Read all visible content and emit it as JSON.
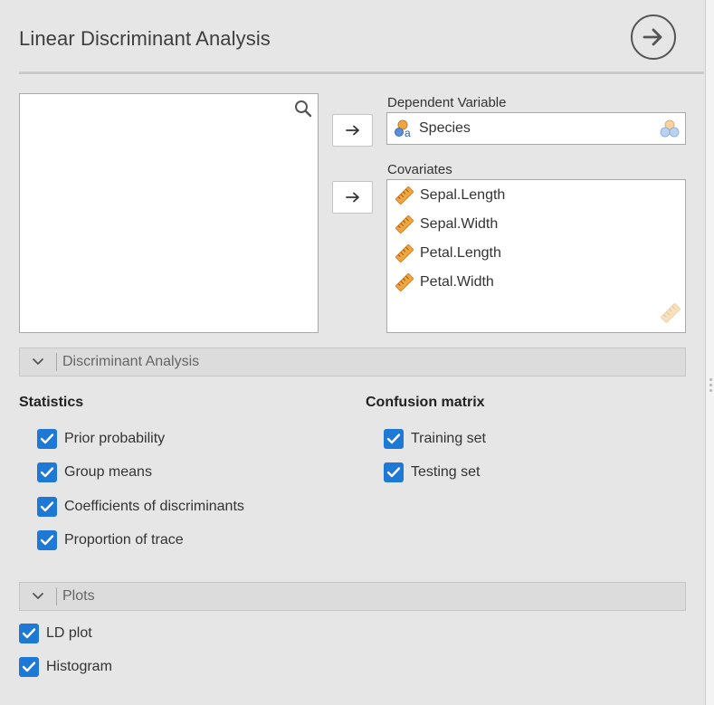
{
  "header": {
    "title": "Linear Discriminant Analysis"
  },
  "variables": {
    "dependent_label": "Dependent Variable",
    "dependent": [
      {
        "label": "Species",
        "icon": "nominal-variable-icon"
      }
    ],
    "covariates_label": "Covariates",
    "covariates": [
      {
        "label": "Sepal.Length",
        "icon": "continuous-variable-icon"
      },
      {
        "label": "Sepal.Width",
        "icon": "continuous-variable-icon"
      },
      {
        "label": "Petal.Length",
        "icon": "continuous-variable-icon"
      },
      {
        "label": "Petal.Width",
        "icon": "continuous-variable-icon"
      }
    ]
  },
  "sections": {
    "discriminant": {
      "header": "Discriminant Analysis",
      "statistics": {
        "title": "Statistics",
        "items": [
          {
            "label": "Prior probability",
            "checked": true
          },
          {
            "label": "Group means",
            "checked": true
          },
          {
            "label": "Coefficients of discriminants",
            "checked": true
          },
          {
            "label": "Proportion of trace",
            "checked": true
          }
        ]
      },
      "confusion": {
        "title": "Confusion matrix",
        "items": [
          {
            "label": "Training set",
            "checked": true
          },
          {
            "label": "Testing set",
            "checked": true
          }
        ]
      }
    },
    "plots": {
      "header": "Plots",
      "items": [
        {
          "label": "LD plot",
          "checked": true
        },
        {
          "label": "Histogram",
          "checked": true
        }
      ]
    }
  },
  "colors": {
    "checkbox": "#1e78d6",
    "ruler": "#e8a23a",
    "nominal_blue": "#5b8fd6",
    "nominal_orange": "#f0a640"
  }
}
